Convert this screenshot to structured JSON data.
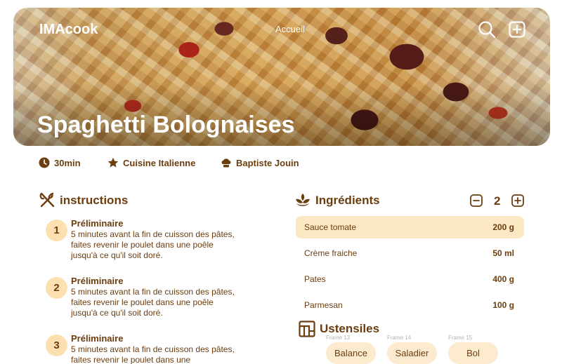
{
  "header": {
    "logo": "IMAcook",
    "nav": {
      "home": "Accueil"
    },
    "icons": {
      "search": "search-icon",
      "add": "add-square-icon"
    }
  },
  "recipe": {
    "title": "Spaghetti Bolognaises",
    "meta": {
      "time": "30min",
      "cuisine": "Cuisine Italienne",
      "author": "Baptiste Jouin"
    }
  },
  "instructions": {
    "title": "instructions",
    "steps": [
      {
        "number": "1",
        "title": "Préliminaire",
        "text": "5 minutes avant la fin de cuisson des pâtes, faites revenir le poulet dans une poêle jusqu'à ce qu'il soit doré."
      },
      {
        "number": "2",
        "title": "Préliminaire",
        "text": "5 minutes avant la fin de cuisson des pâtes, faites revenir le poulet dans une poêle jusqu'à ce qu'il soit doré."
      },
      {
        "number": "3",
        "title": "Préliminaire",
        "text": "5 minutes avant la fin de cuisson des pâtes, faites revenir le poulet dans une"
      }
    ]
  },
  "ingredients": {
    "title": "Ingrédients",
    "servings": "2",
    "items": [
      {
        "name": "Sauce tomate",
        "qty": "200 g"
      },
      {
        "name": "Crème fraiche",
        "qty": "50 ml"
      },
      {
        "name": "Pates",
        "qty": "400 g"
      },
      {
        "name": "Parmesan",
        "qty": "100 g"
      }
    ]
  },
  "utensils": {
    "title": "Ustensiles",
    "items": [
      {
        "frame": "Frame 13",
        "label": "Balance"
      },
      {
        "frame": "Frame 14",
        "label": "Saladier"
      },
      {
        "frame": "Frame 15",
        "label": "Bol"
      }
    ]
  },
  "colors": {
    "accent": "#6b3d0f",
    "highlight": "#fde8c6",
    "chip": "#fdebd0",
    "step_badge": "#fde0b0"
  }
}
